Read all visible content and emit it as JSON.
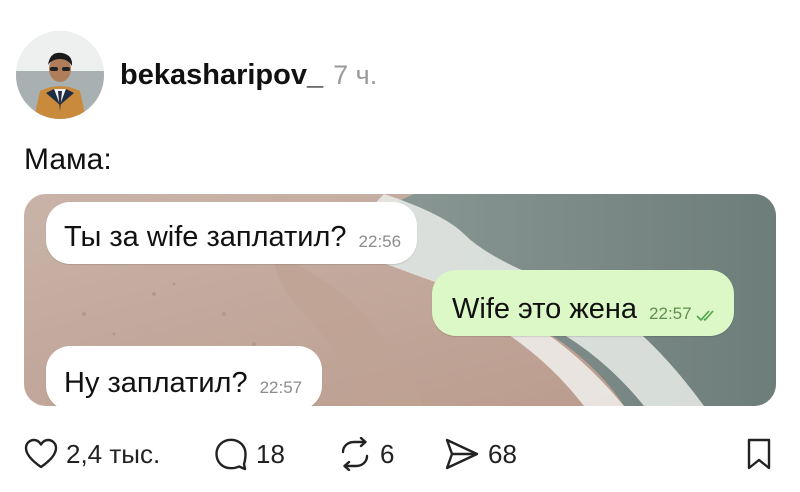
{
  "post": {
    "username": "bekasharipov_",
    "time": "7 ч.",
    "caption": "Мама:"
  },
  "messages": [
    {
      "text": "Ты за wife заплатил?",
      "time": "22:56",
      "direction": "incoming"
    },
    {
      "text": "Wife это жена",
      "time": "22:57",
      "direction": "outgoing",
      "status": "read-double-check"
    },
    {
      "text": "Ну заплатил?",
      "time": "22:57",
      "direction": "incoming"
    }
  ],
  "actions": {
    "likes": "2,4 тыс.",
    "comments": "18",
    "reposts": "6",
    "shares": "68"
  },
  "colors": {
    "incoming_bubble": "#ffffff",
    "outgoing_bubble": "#dcf8c6",
    "timestamp": "#8c8c8c",
    "read_check": "#4fa34a"
  },
  "icons": [
    "heart-icon",
    "comment-icon",
    "repost-icon",
    "share-icon",
    "bookmark-icon"
  ]
}
